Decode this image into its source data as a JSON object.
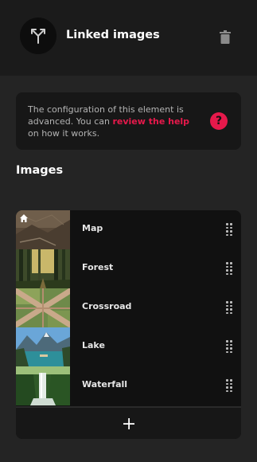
{
  "header": {
    "title": "Linked images",
    "icon": "split-arrows-icon",
    "delete_icon": "trash-icon"
  },
  "info": {
    "text_before": "The configuration of this element is advanced. You can ",
    "link_text": "review the help",
    "text_after": " on how it works.",
    "help_icon_glyph": "?",
    "accent_color": "#e6194b"
  },
  "images_section": {
    "title": "Images",
    "items": [
      {
        "label": "Map",
        "home": true
      },
      {
        "label": "Forest"
      },
      {
        "label": "Crossroad"
      },
      {
        "label": "Lake"
      },
      {
        "label": "Waterfall"
      }
    ],
    "add_icon": "plus-icon"
  }
}
